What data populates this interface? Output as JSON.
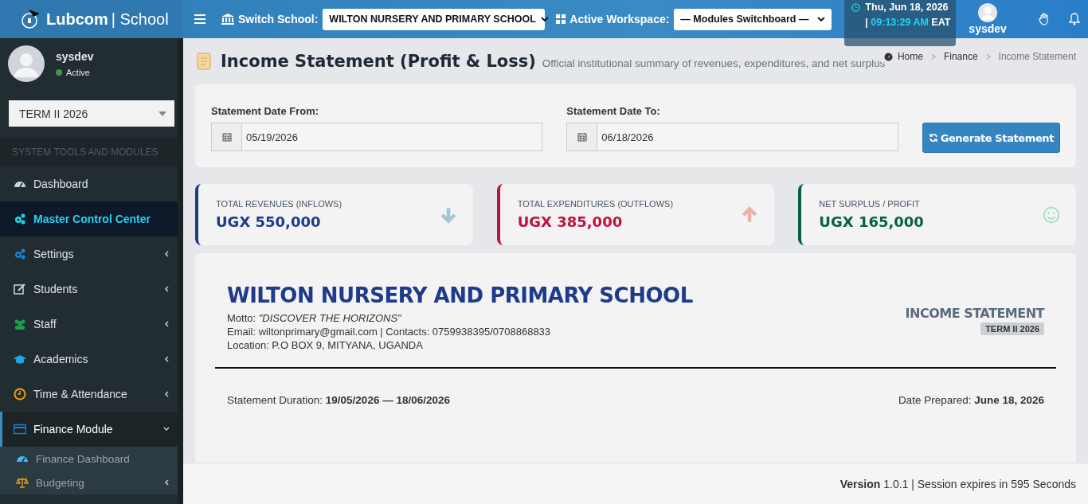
{
  "brand": {
    "name": "Lubcom",
    "suffix": "| School"
  },
  "header": {
    "switch_label": "Switch School:",
    "school_select": "WILTON NURSERY AND PRIMARY SCHOOL",
    "workspace_label": "Active Workspace:",
    "workspace_select": "— Modules Switchboard —",
    "clock_date": "Thu, Jun 18, 2026 |",
    "clock_time": "09:13:29 AM",
    "clock_zone": "EAT",
    "user": "sysdev"
  },
  "sidebar": {
    "user": "sysdev",
    "status": "Active",
    "term_select": "TERM II 2026",
    "section": "SYSTEM TOOLS AND MODULES",
    "items": [
      {
        "kind": "gauge",
        "label": "Dashboard",
        "selected": false
      },
      {
        "kind": "gears",
        "label": "Master Control Center",
        "selected": true
      },
      {
        "kind": "gears",
        "label": "Settings",
        "selected": false,
        "expanded": false
      },
      {
        "kind": "edit",
        "label": "Students",
        "selected": false,
        "expanded": false
      },
      {
        "kind": "users",
        "label": "Staff",
        "selected": false,
        "expanded": false
      },
      {
        "kind": "cap",
        "label": "Academics",
        "selected": false,
        "expanded": false
      },
      {
        "kind": "clock",
        "label": "Time & Attendance",
        "selected": false,
        "expanded": false
      },
      {
        "kind": "card",
        "label": "Finance Module",
        "selected": false,
        "expanded": true,
        "children": [
          {
            "kind": "gauge",
            "label": "Finance Dashboard"
          },
          {
            "kind": "scale",
            "label": "Budgeting",
            "expanded": false
          }
        ]
      }
    ]
  },
  "page": {
    "title": "Income Statement (Profit & Loss)",
    "subtitle": "Official institutional summary of revenues, expenditures, and net surplus",
    "breadcrumbs": [
      "Home",
      "Finance",
      "Income Statement"
    ]
  },
  "filters": {
    "from_label": "Statement Date From:",
    "from_value": "05/19/2026",
    "to_label": "Statement Date To:",
    "to_value": "06/18/2026",
    "button": "Generate Statement"
  },
  "summary": [
    {
      "kind": "down",
      "label": "TOTAL REVENUES (INFLOWS)",
      "value": "UGX 550,000",
      "color": "#1e3a8a"
    },
    {
      "kind": "up",
      "label": "TOTAL EXPENDITURES (OUTFLOWS)",
      "value": "UGX 385,000",
      "color": "#be123c"
    },
    {
      "kind": "smile",
      "label": "NET SURPLUS / PROFIT",
      "value": "UGX 165,000",
      "color": "#065f46"
    }
  ],
  "statement": {
    "school": "WILTON NURSERY AND PRIMARY SCHOOL",
    "motto_label": "Motto:",
    "motto": "\"DISCOVER THE HORIZONS\"",
    "contacts": "Email: wiltonprimary@gmail.com | Contacts: 0759938395/0708868833",
    "location": "Location: P.O BOX 9, MITYANA, UGANDA",
    "doc_title": "INCOME STATEMENT",
    "term": "TERM II 2026",
    "duration": "Statement Duration: **19/05/2026 — 18/06/2026**",
    "prepared": "Date Prepared: **June 18, 2026**"
  },
  "footer": "**Version** 1.0.1 | Session expires in 595 Seconds"
}
